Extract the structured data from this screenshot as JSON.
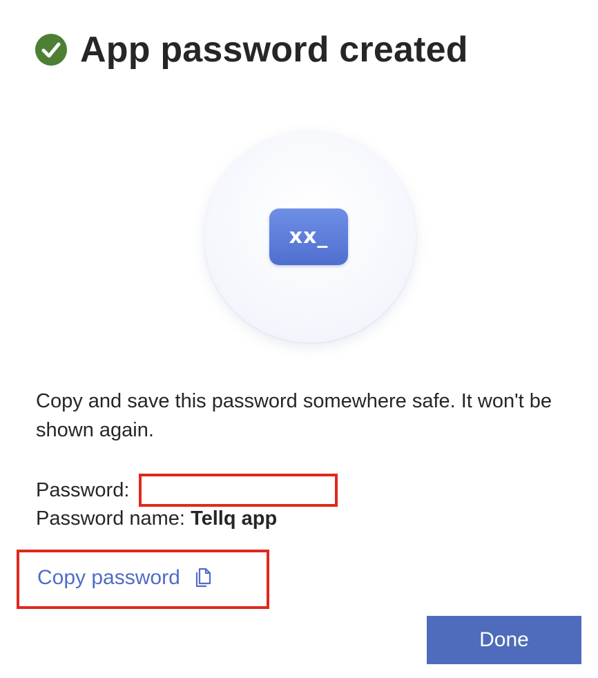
{
  "header": {
    "title": "App password created",
    "status_icon": "success-check-icon",
    "status_color": "#4d7f34"
  },
  "illustration": {
    "badge_text": "xx_",
    "badge_color": "#5a7bd9"
  },
  "instructions": {
    "text": "Copy and save this password somewhere safe. It won't be shown again."
  },
  "details": {
    "password_label": "Password:",
    "password_value": "",
    "name_label": "Password name:",
    "name_value": "Tellq app"
  },
  "actions": {
    "copy_label": "Copy password",
    "copy_icon": "copy-icon",
    "done_label": "Done"
  },
  "colors": {
    "link": "#4f6cc7",
    "primary_button": "#4e6cbb",
    "highlight_box": "#e0281d"
  }
}
